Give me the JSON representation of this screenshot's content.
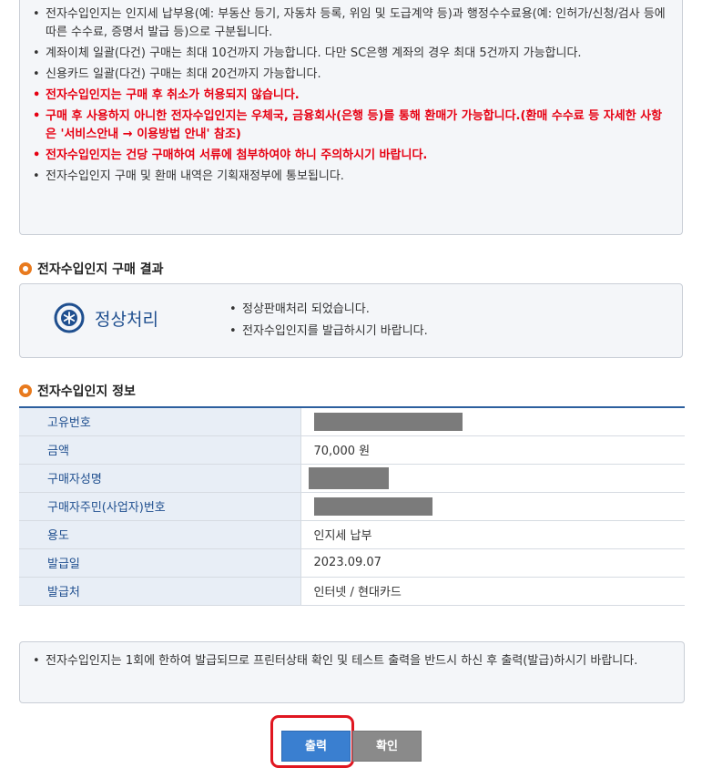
{
  "top_notices": [
    {
      "text": "전자수입인지는 인지세 납부용(예: 부동산 등기, 자동차 등록, 위임 및 도급계약 등)과 행정수수료용(예: 인허가/신청/검사 등에 따른 수수료, 증명서 발급 등)으로 구분됩니다.",
      "emphasis": false
    },
    {
      "text": "계좌이체 일괄(다건) 구매는 최대 10건까지 가능합니다. 다만 SC은행 계좌의 경우 최대 5건까지 가능합니다.",
      "emphasis": false
    },
    {
      "text": "신용카드 일괄(다건) 구매는 최대 20건까지 가능합니다.",
      "emphasis": false
    },
    {
      "text": "전자수입인지는 구매 후 취소가 허용되지 않습니다.",
      "emphasis": true
    },
    {
      "text": "구매 후 사용하지 아니한 전자수입인지는 우체국, 금융회사(은행 등)를 통해 환매가 가능합니다.(환매 수수료 등 자세한 사항은 '서비스안내 → 이용방법 안내' 참조)",
      "emphasis": true
    },
    {
      "text": "전자수입인지는 건당 구매하여 서류에 첨부하여야 하니 주의하시기 바랍니다.",
      "emphasis": true
    },
    {
      "text": "전자수입인지 구매 및 환매 내역은 기획재정부에 통보됩니다.",
      "emphasis": false
    }
  ],
  "purchase_result": {
    "section_title": "전자수입인지 구매 결과",
    "status_label": "정상처리",
    "messages": [
      "정상판매처리 되었습니다.",
      "전자수입인지를 발급하시기 바랍니다."
    ]
  },
  "stamp_info": {
    "section_title": "전자수입인지 정보",
    "rows": [
      {
        "label": "고유번호",
        "value": "",
        "masked": true
      },
      {
        "label": "금액",
        "value": "70,000 원",
        "masked": false
      },
      {
        "label": "구매자성명",
        "value": "",
        "masked": true
      },
      {
        "label": "구매자주민(사업자)번호",
        "value": "",
        "masked": true
      },
      {
        "label": "용도",
        "value": "인지세 납부",
        "masked": false
      },
      {
        "label": "발급일",
        "value": "2023.09.07",
        "masked": false
      },
      {
        "label": "발급처",
        "value": "인터넷 / 현대카드",
        "masked": false
      }
    ]
  },
  "bottom_notice": "전자수입인지는 1회에 한하여 발급되므로 프린터상태 확인 및 테스트 출력을 반드시 하신 후 출력(발급)하시기 바랍니다.",
  "buttons": {
    "print_label": "출력",
    "confirm_label": "확인"
  },
  "icons": {
    "section": "orange-circle-bullet-icon",
    "status": "asterisk-badge-icon"
  },
  "colors": {
    "emphasis": "#e60012",
    "accent_blue": "#1f4f8f",
    "print_button": "#3a7fd0",
    "confirm_button": "#8a8a8a",
    "highlight": "#e01620"
  }
}
